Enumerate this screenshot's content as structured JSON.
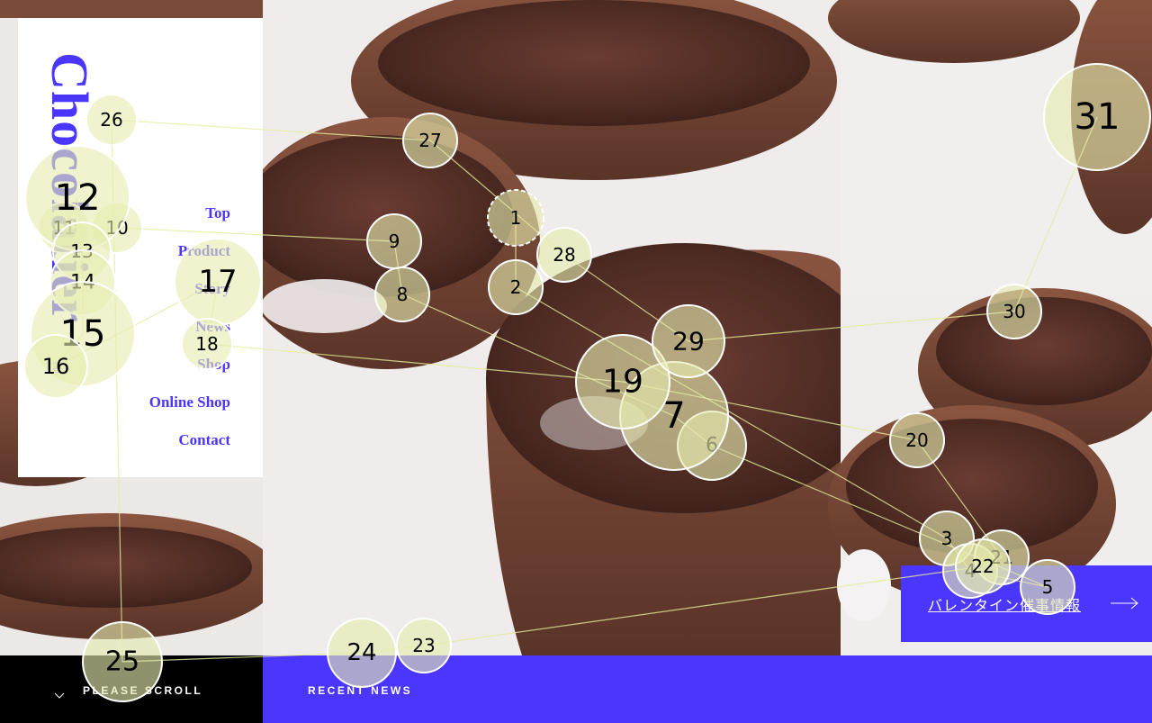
{
  "brand": {
    "logo_text": "Chocolatier",
    "tm": "TM"
  },
  "nav": {
    "items": [
      {
        "label": "Top"
      },
      {
        "label": "Product"
      },
      {
        "label": "Story"
      },
      {
        "label": "News"
      },
      {
        "label": "Shop"
      },
      {
        "label": "Online Shop"
      },
      {
        "label": "Contact"
      }
    ]
  },
  "cta": {
    "label": "バレンタイン催事情報"
  },
  "footer": {
    "scroll_label": "PLEASE SCROLL",
    "news_label": "RECENT NEWS"
  },
  "colors": {
    "accent": "#4a36ff",
    "fixation_fill": "#e6ebb0",
    "gaze_line": "#e6ec9a"
  },
  "gaze_fixations": [
    {
      "label": "1"
    },
    {
      "label": "2"
    },
    {
      "label": "3"
    },
    {
      "label": "4"
    },
    {
      "label": "5"
    },
    {
      "label": "6"
    },
    {
      "label": "7"
    },
    {
      "label": "8"
    },
    {
      "label": "9"
    },
    {
      "label": "10"
    },
    {
      "label": "11"
    },
    {
      "label": "12"
    },
    {
      "label": "13"
    },
    {
      "label": "14"
    },
    {
      "label": "15"
    },
    {
      "label": "16"
    },
    {
      "label": "17"
    },
    {
      "label": "18"
    },
    {
      "label": "19"
    },
    {
      "label": "20"
    },
    {
      "label": "21"
    },
    {
      "label": "22"
    },
    {
      "label": "23"
    },
    {
      "label": "24"
    },
    {
      "label": "25"
    },
    {
      "label": "26"
    },
    {
      "label": "27"
    },
    {
      "label": "28"
    },
    {
      "label": "29"
    },
    {
      "label": "30"
    },
    {
      "label": "31"
    }
  ]
}
